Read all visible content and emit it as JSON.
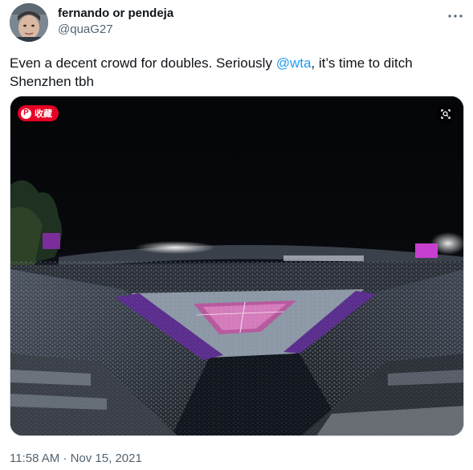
{
  "user": {
    "display_name": "fernando or pendeja",
    "handle": "@quaG27",
    "avatar_icon": "profile-photo"
  },
  "tweet": {
    "text_before": "Even a decent crowd for doubles. Seriously ",
    "mention": "@wta",
    "text_after": ", it’s time to ditch Shenzhen tbh",
    "timestamp": "11:58 AM · Nov 15, 2021"
  },
  "media": {
    "save_badge_label": "收藏",
    "save_badge_icon": "pinterest-icon",
    "lens_icon": "search-image-icon"
  },
  "colors": {
    "link": "#1d9bf0",
    "secondary_text": "#536471",
    "pinterest": "#e60023"
  }
}
